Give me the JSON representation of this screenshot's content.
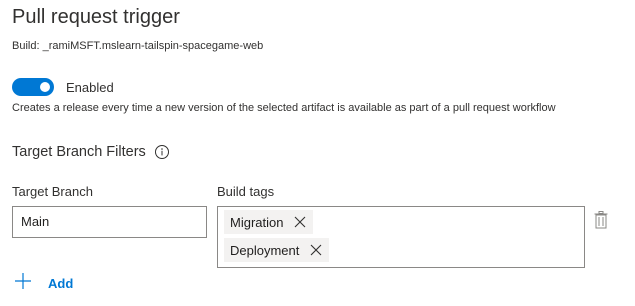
{
  "header": {
    "title": "Pull request trigger",
    "build_info": "Build: _ramiMSFT.mslearn-tailspin-spacegame-web"
  },
  "toggle": {
    "label": "Enabled",
    "state": "on",
    "accent_color": "#0078d4"
  },
  "description": "Creates a release every time a new version of the selected artifact is available as part of a pull request workflow",
  "filters": {
    "section_title": "Target Branch Filters",
    "info_icon": "info-icon",
    "target_branch_label": "Target Branch",
    "target_branch_value": "Main",
    "build_tags_label": "Build tags",
    "tags": [
      {
        "label": "Migration"
      },
      {
        "label": "Deployment"
      }
    ],
    "delete_icon": "trash-icon"
  },
  "actions": {
    "add_label": "Add",
    "add_icon": "plus-icon"
  }
}
